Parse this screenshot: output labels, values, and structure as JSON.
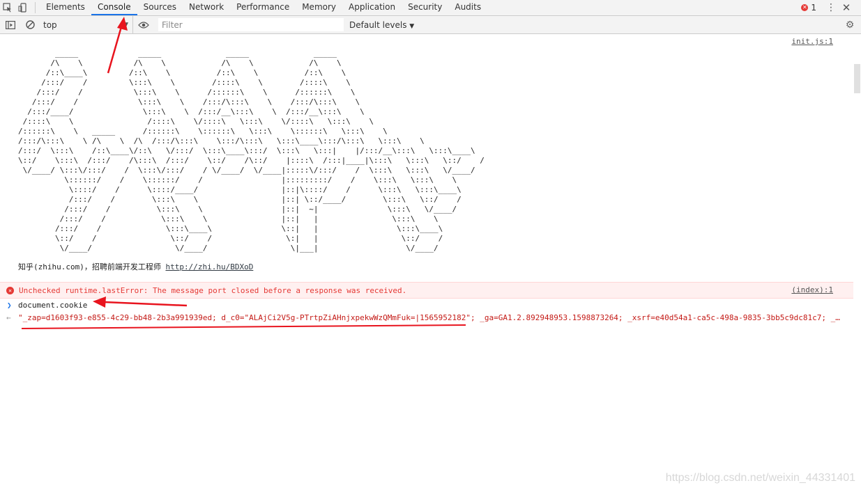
{
  "tabs": [
    "Elements",
    "Console",
    "Sources",
    "Network",
    "Performance",
    "Memory",
    "Application",
    "Security",
    "Audits"
  ],
  "active_tab": "Console",
  "error_badge": {
    "count": "1"
  },
  "toolbar": {
    "context": "top",
    "filter_placeholder": "Filter",
    "levels": "Default levels"
  },
  "console": {
    "init_link": "init.js:1",
    "ascii_art": "        _____             _____              _____              _____\n       /\\    \\           /\\    \\            /\\    \\            /\\    \\\n      /::\\____\\         /::\\    \\          /::\\    \\          /::\\    \\\n     /:::/    /         \\:::\\    \\        /::::\\    \\        /::::\\    \\\n    /:::/    /           \\:::\\    \\      /::::::\\    \\      /::::::\\    \\\n   /:::/    /             \\:::\\    \\    /:::/\\:::\\    \\    /:::/\\:::\\    \\\n  /:::/____/               \\:::\\    \\  /:::/__\\:::\\    \\  /:::/__\\:::\\    \\\n /::::\\    \\                /::::\\    \\/::::\\   \\:::\\    \\/::::\\   \\:::\\    \\\n/::::::\\    \\   _____      /::::::\\    \\::::::\\   \\:::\\    \\::::::\\   \\:::\\    \\\n/:::/\\:::\\    \\ /\\    \\  /\\  /:::/\\:::\\    \\:::/\\:::\\   \\:::\\____\\:::/\\:::\\   \\:::\\    \\\n/:::/  \\:::\\    /::\\____\\/::\\   \\/:::/  \\:::\\____\\:::/  \\:::\\   \\:::|    |/:::/__\\:::\\   \\:::\\____\\\n\\::/    \\:::\\  /:::/    /\\:::\\  /:::/    \\::/    /\\::/    |::::\\  /:::|____|\\:::\\   \\:::\\   \\::/    /\n \\/____/ \\:::\\/:::/    /  \\:::\\/:::/    / \\/____/  \\/____|:::::\\/:::/    /  \\:::\\   \\:::\\   \\/____/\n          \\::::::/    /    \\::::::/    /                 |:::::::::/    /    \\:::\\   \\:::\\    \\\n           \\::::/    /      \\::::/____/                  |::|\\::::/    /      \\:::\\   \\:::\\____\\\n           /:::/    /        \\:::\\    \\                  |::| \\::/____/        \\:::\\   \\::/    /\n          /:::/    /          \\:::\\    \\                 |::|  ~|               \\:::\\   \\/____/\n         /:::/    /            \\:::\\    \\                |::|   |                \\:::\\    \\\n        /:::/    /              \\:::\\____\\               \\::|   |                 \\:::\\____\\\n        \\::/    /                \\::/    /                \\:|   |                  \\::/    /\n         \\/____/                  \\/____/                  \\|___|                   \\/____/",
    "zhihu_text": "知乎(zhihu.com)，招聘前端开发工程师",
    "zhihu_link": "http://zhi.hu/BDXoD",
    "error_message": "Unchecked runtime.lastError: The message port closed before a response was received.",
    "error_source": "(index):1",
    "input_command": "document.cookie",
    "cookie_result": "\"_zap=d1603f93-e855-4c29-bb48-2b3a991939ed; d_c0=\"ALAjCi2V5g-PTrtpZiAHnjxpekwWzQMmFuk=|1565952182\"; _ga=GA1.2.892948953.1598873264; _xsrf=e40d54a1-ca5c-498a-9835-3bb5c9dc81c7; _…"
  },
  "watermark": "https://blog.csdn.net/weixin_44331401",
  "colors": {
    "accent": "#1a73e8",
    "error": "#e53935",
    "annotation": "#e8141e"
  }
}
